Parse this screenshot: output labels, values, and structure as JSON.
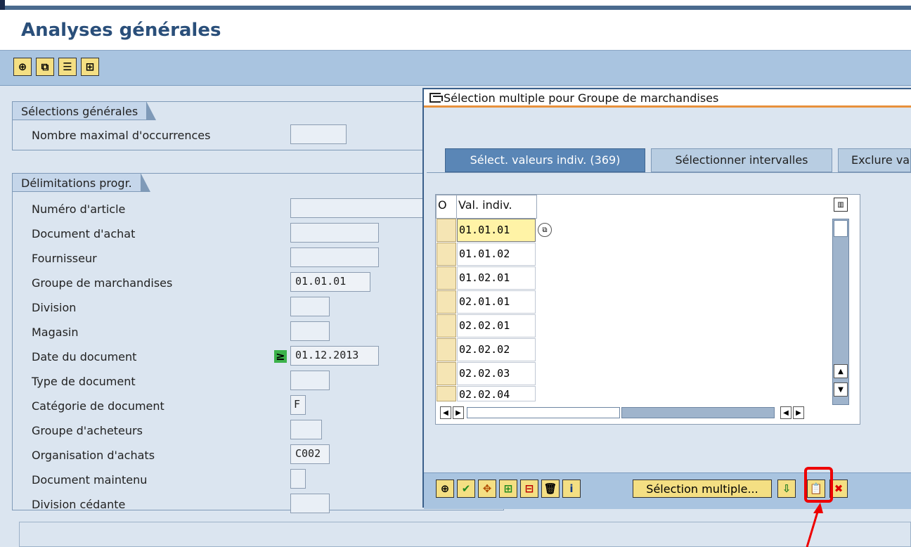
{
  "page_title": "Analyses générales",
  "toolbar": {
    "icons": [
      "execute-icon",
      "copy-variant-icon",
      "list-icon",
      "expand-icon"
    ]
  },
  "general_selections": {
    "group_label": "Sélections générales",
    "max_hits_label": "Nombre maximal d'occurrences",
    "max_hits_value": ""
  },
  "prog_delimitations": {
    "group_label": "Délimitations progr.",
    "fields": [
      {
        "label": "Numéro d'article",
        "value": ""
      },
      {
        "label": "Document d'achat",
        "value": ""
      },
      {
        "label": "Fournisseur",
        "value": ""
      },
      {
        "label": "Groupe de marchandises",
        "value": "01.01.01"
      },
      {
        "label": "Division",
        "value": ""
      },
      {
        "label": "Magasin",
        "value": ""
      },
      {
        "label": "Date du document",
        "value": "01.12.2013",
        "operator": "≥"
      },
      {
        "label": "Type de document",
        "value": ""
      },
      {
        "label": "Catégorie de document",
        "value": "F"
      },
      {
        "label": "Groupe d'acheteurs",
        "value": ""
      },
      {
        "label": "Organisation d'achats",
        "value": "C002"
      },
      {
        "label": "Document maintenu",
        "value": ""
      },
      {
        "label": "Division cédante",
        "value": ""
      }
    ]
  },
  "dialog": {
    "title": "Sélection multiple pour Groupe de marchandises",
    "tabs": [
      {
        "label": "Sélect. valeurs indiv. (369)",
        "active": true
      },
      {
        "label": "Sélectionner intervalles",
        "active": false
      },
      {
        "label": "Exclure va",
        "active": false
      }
    ],
    "grid": {
      "col_o": "O",
      "col_val": "Val. indiv.",
      "rows": [
        "01.01.01",
        "01.01.02",
        "01.02.01",
        "02.01.01",
        "02.02.01",
        "02.02.02",
        "02.02.03",
        "02.02.04"
      ]
    },
    "footer": {
      "multi_select_label": "Sélection multiple...",
      "icons": [
        "execute-icon",
        "checkmark-icon",
        "variant-icon",
        "insert-line-icon",
        "delete-line-icon",
        "trash-icon",
        "info-icon",
        "import-icon",
        "upload-clipboard-icon",
        "cancel-icon"
      ]
    }
  },
  "colors": {
    "title_blue": "#2a4f7a",
    "toolbar_bg": "#a9c4e0",
    "panel_bg": "#dbe5f0",
    "button_yellow": "#f4df83",
    "highlight_red": "#e00000",
    "dialog_title_underline": "#e8913c"
  }
}
